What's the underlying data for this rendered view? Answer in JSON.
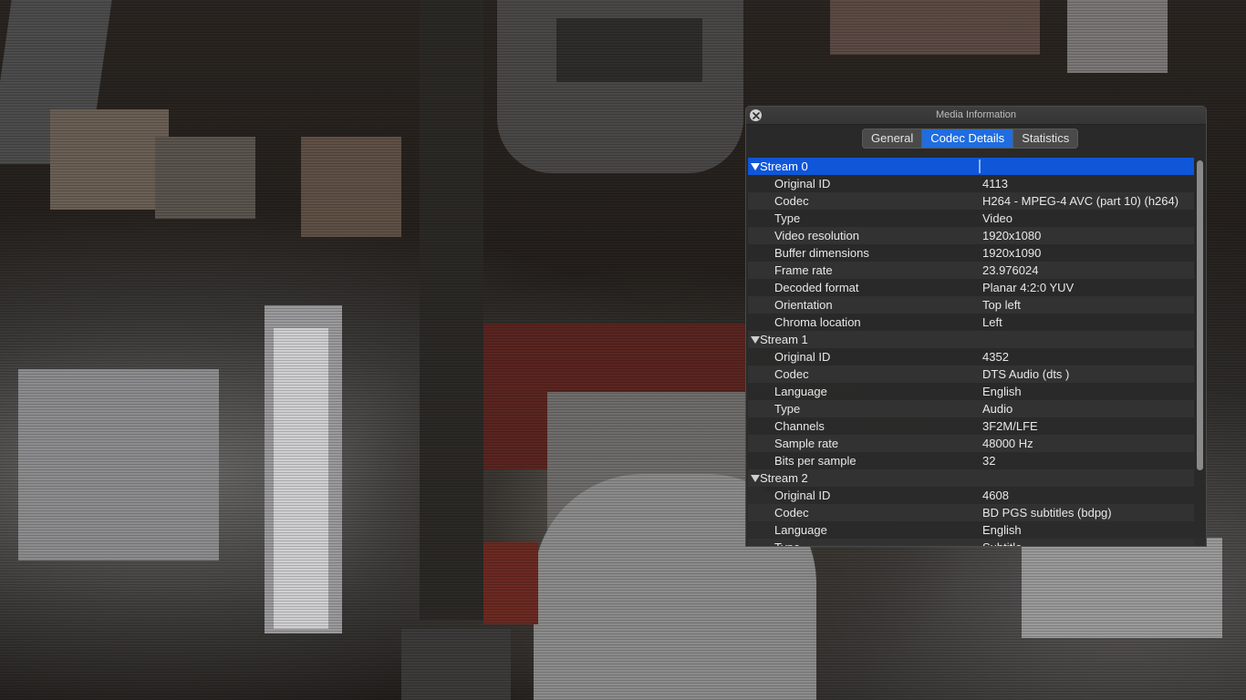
{
  "window": {
    "title": "Media Information",
    "tabs": [
      {
        "label": "General",
        "active": false
      },
      {
        "label": "Codec Details",
        "active": true
      },
      {
        "label": "Statistics",
        "active": false
      }
    ]
  },
  "streams": [
    {
      "name": "Stream 0",
      "fields": [
        {
          "key": "Original ID",
          "value": "4113"
        },
        {
          "key": "Codec",
          "value": "H264 - MPEG-4 AVC (part 10) (h264)"
        },
        {
          "key": "Type",
          "value": "Video"
        },
        {
          "key": "Video resolution",
          "value": "1920x1080"
        },
        {
          "key": "Buffer dimensions",
          "value": "1920x1090"
        },
        {
          "key": "Frame rate",
          "value": "23.976024"
        },
        {
          "key": "Decoded format",
          "value": "Planar 4:2:0 YUV"
        },
        {
          "key": "Orientation",
          "value": "Top left"
        },
        {
          "key": "Chroma location",
          "value": "Left"
        }
      ]
    },
    {
      "name": "Stream 1",
      "fields": [
        {
          "key": "Original ID",
          "value": "4352"
        },
        {
          "key": "Codec",
          "value": "DTS Audio (dts )"
        },
        {
          "key": "Language",
          "value": "English"
        },
        {
          "key": "Type",
          "value": "Audio"
        },
        {
          "key": "Channels",
          "value": "3F2M/LFE"
        },
        {
          "key": "Sample rate",
          "value": "48000 Hz"
        },
        {
          "key": "Bits per sample",
          "value": "32"
        }
      ]
    },
    {
      "name": "Stream 2",
      "fields": [
        {
          "key": "Original ID",
          "value": "4608"
        },
        {
          "key": "Codec",
          "value": "BD PGS subtitles (bdpg)"
        },
        {
          "key": "Language",
          "value": "English"
        },
        {
          "key": "Type",
          "value": "Subtitle"
        }
      ]
    }
  ],
  "colors": {
    "accent": "#1f6de0",
    "selection": "#0f56d9",
    "panel_bg": "#2a2a2a"
  },
  "icons": {
    "close": "close-icon",
    "disclosure": "disclosure-triangle-icon"
  }
}
